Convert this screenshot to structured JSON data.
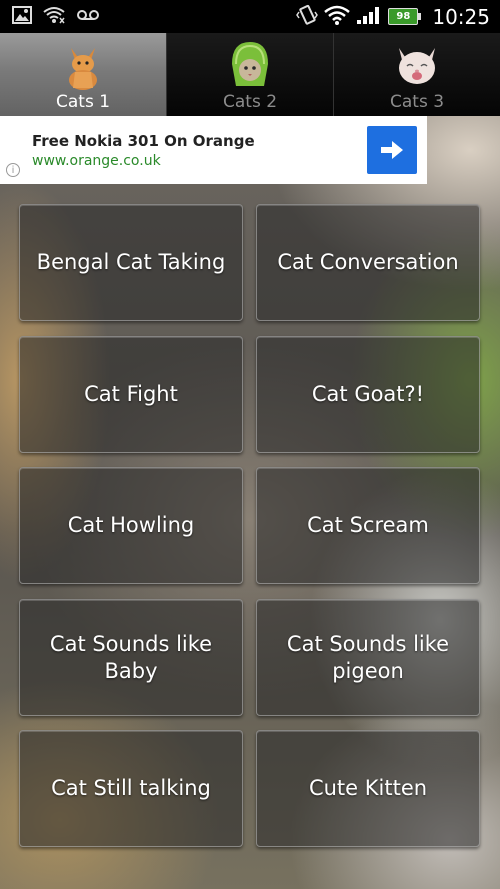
{
  "status_bar": {
    "time": "10:25",
    "battery": "98",
    "icons": [
      "image-icon",
      "wifi-signal-icon",
      "voicemail-icon",
      "vibrate-icon",
      "wifi-icon",
      "cell-signal-icon",
      "battery-icon"
    ]
  },
  "tabs": [
    {
      "label": "Cats 1",
      "active": true,
      "thumb": "orange-kitten"
    },
    {
      "label": "Cats 2",
      "active": false,
      "thumb": "melon-helmet-cat"
    },
    {
      "label": "Cats 3",
      "active": false,
      "thumb": "white-kitten"
    }
  ],
  "ad": {
    "title": "Free Nokia 301 On Orange",
    "url": "www.orange.co.uk",
    "info_icon": "i",
    "accent": "#1e6fe0"
  },
  "sounds": [
    {
      "label": "Bengal Cat Taking"
    },
    {
      "label": "Cat Conversation"
    },
    {
      "label": "Cat Fight"
    },
    {
      "label": "Cat Goat?!"
    },
    {
      "label": "Cat Howling"
    },
    {
      "label": "Cat Scream"
    },
    {
      "label": "Cat Sounds like Baby"
    },
    {
      "label": "Cat Sounds like pigeon"
    },
    {
      "label": "Cat Still talking"
    },
    {
      "label": "Cute Kitten"
    }
  ]
}
